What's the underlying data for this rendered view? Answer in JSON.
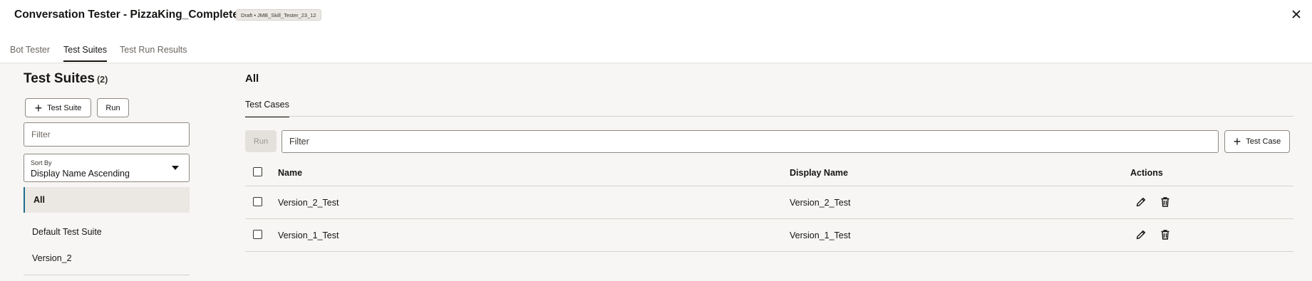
{
  "header": {
    "title": "Conversation Tester - PizzaKing_Complete",
    "badge": "Draft • JMB_Skill_Tester_23_12",
    "close_icon": "close-icon"
  },
  "tabs": [
    {
      "label": "Bot Tester",
      "active": false
    },
    {
      "label": "Test Suites",
      "active": true
    },
    {
      "label": "Test Run Results",
      "active": false
    }
  ],
  "left": {
    "heading": "Test Suites",
    "count": "(2)",
    "add_button": "Test Suite",
    "run_button": "Run",
    "filter_placeholder": "Filter",
    "sort_label": "Sort By",
    "sort_value": "Display Name Ascending",
    "items": [
      {
        "label": "All",
        "selected": true
      },
      {
        "label": "Default Test Suite",
        "selected": false
      },
      {
        "label": "Version_2",
        "selected": false
      }
    ]
  },
  "right": {
    "heading": "All",
    "subtab": "Test Cases",
    "run_button": "Run",
    "filter_placeholder": "Filter",
    "add_button": "Test Case",
    "columns": {
      "name": "Name",
      "display_name": "Display Name",
      "actions": "Actions"
    },
    "rows": [
      {
        "name": "Version_2_Test",
        "display_name": "Version_2_Test"
      },
      {
        "name": "Version_1_Test",
        "display_name": "Version_1_Test"
      }
    ]
  },
  "colors": {
    "accent": "#1f6d8f",
    "text": "#161513",
    "background": "#f7f6f4"
  }
}
